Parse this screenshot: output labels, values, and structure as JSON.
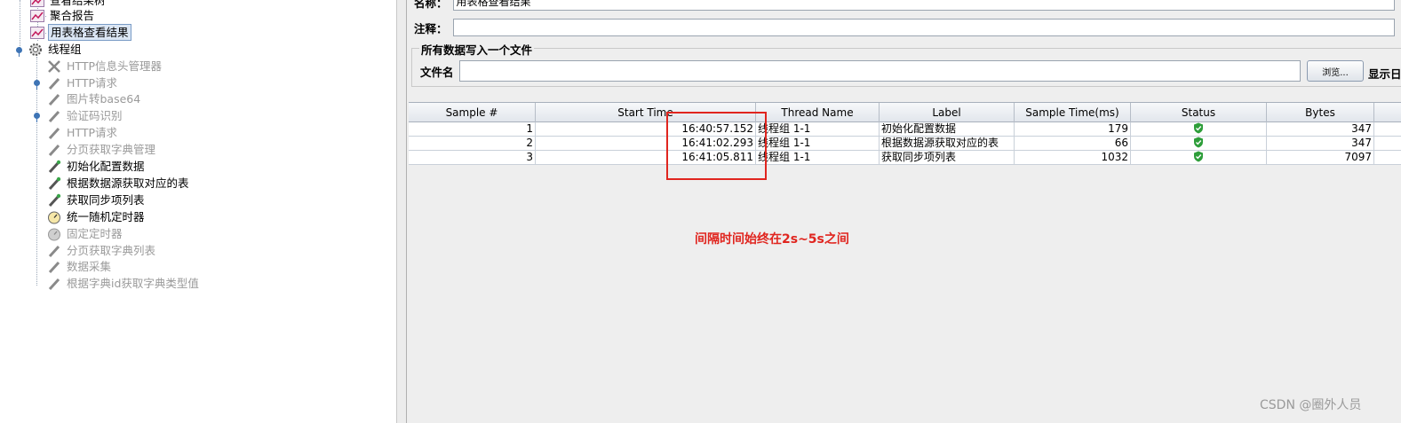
{
  "tree": {
    "items": [
      {
        "label": "查看结果树",
        "state": "normal"
      },
      {
        "label": "聚合报告",
        "state": "normal"
      },
      {
        "label": "用表格查看结果",
        "state": "selected"
      },
      {
        "label": "线程组",
        "state": "normal"
      },
      {
        "label": "HTTP信息头管理器",
        "state": "disabled"
      },
      {
        "label": "HTTP请求",
        "state": "disabled"
      },
      {
        "label": "图片转base64",
        "state": "disabled"
      },
      {
        "label": "验证码识别",
        "state": "disabled"
      },
      {
        "label": "HTTP请求",
        "state": "disabled"
      },
      {
        "label": "分页获取字典管理",
        "state": "disabled"
      },
      {
        "label": "初始化配置数据",
        "state": "normal"
      },
      {
        "label": "根据数据源获取对应的表",
        "state": "normal"
      },
      {
        "label": "获取同步项列表",
        "state": "normal"
      },
      {
        "label": "统一随机定时器",
        "state": "normal"
      },
      {
        "label": "固定定时器",
        "state": "disabled"
      },
      {
        "label": "分页获取字典列表",
        "state": "disabled"
      },
      {
        "label": "数据采集",
        "state": "disabled"
      },
      {
        "label": "根据字典id获取字典类型值",
        "state": "disabled"
      }
    ]
  },
  "form": {
    "name_label": "名称：",
    "name_value": "用表格查看结果",
    "comment_label": "注释：",
    "comment_value": "",
    "file_group_title": "所有数据写入一个文件",
    "filename_label": "文件名",
    "filename_value": "",
    "browse_label": "浏览...",
    "show_log_label": "显示日"
  },
  "table": {
    "headers": [
      "Sample #",
      "Start Time",
      "Thread Name",
      "Label",
      "Sample Time(ms)",
      "Status",
      "Bytes"
    ],
    "rows": [
      {
        "sample": "1",
        "start": "16:40:57.152",
        "thread": "线程组 1-1",
        "label": "初始化配置数据",
        "time": "179",
        "status": "success",
        "bytes": "347"
      },
      {
        "sample": "2",
        "start": "16:41:02.293",
        "thread": "线程组 1-1",
        "label": "根据数据源获取对应的表",
        "time": "66",
        "status": "success",
        "bytes": "347"
      },
      {
        "sample": "3",
        "start": "16:41:05.811",
        "thread": "线程组 1-1",
        "label": "获取同步项列表",
        "time": "1032",
        "status": "success",
        "bytes": "7097"
      }
    ]
  },
  "annotation": "间隔时间始终在2s~5s之间",
  "watermark": "CSDN @圈外人员",
  "colors": {
    "annotation": "#e0251f",
    "status_ok": "#2e9e3a",
    "selection": "#dbe6f4"
  }
}
